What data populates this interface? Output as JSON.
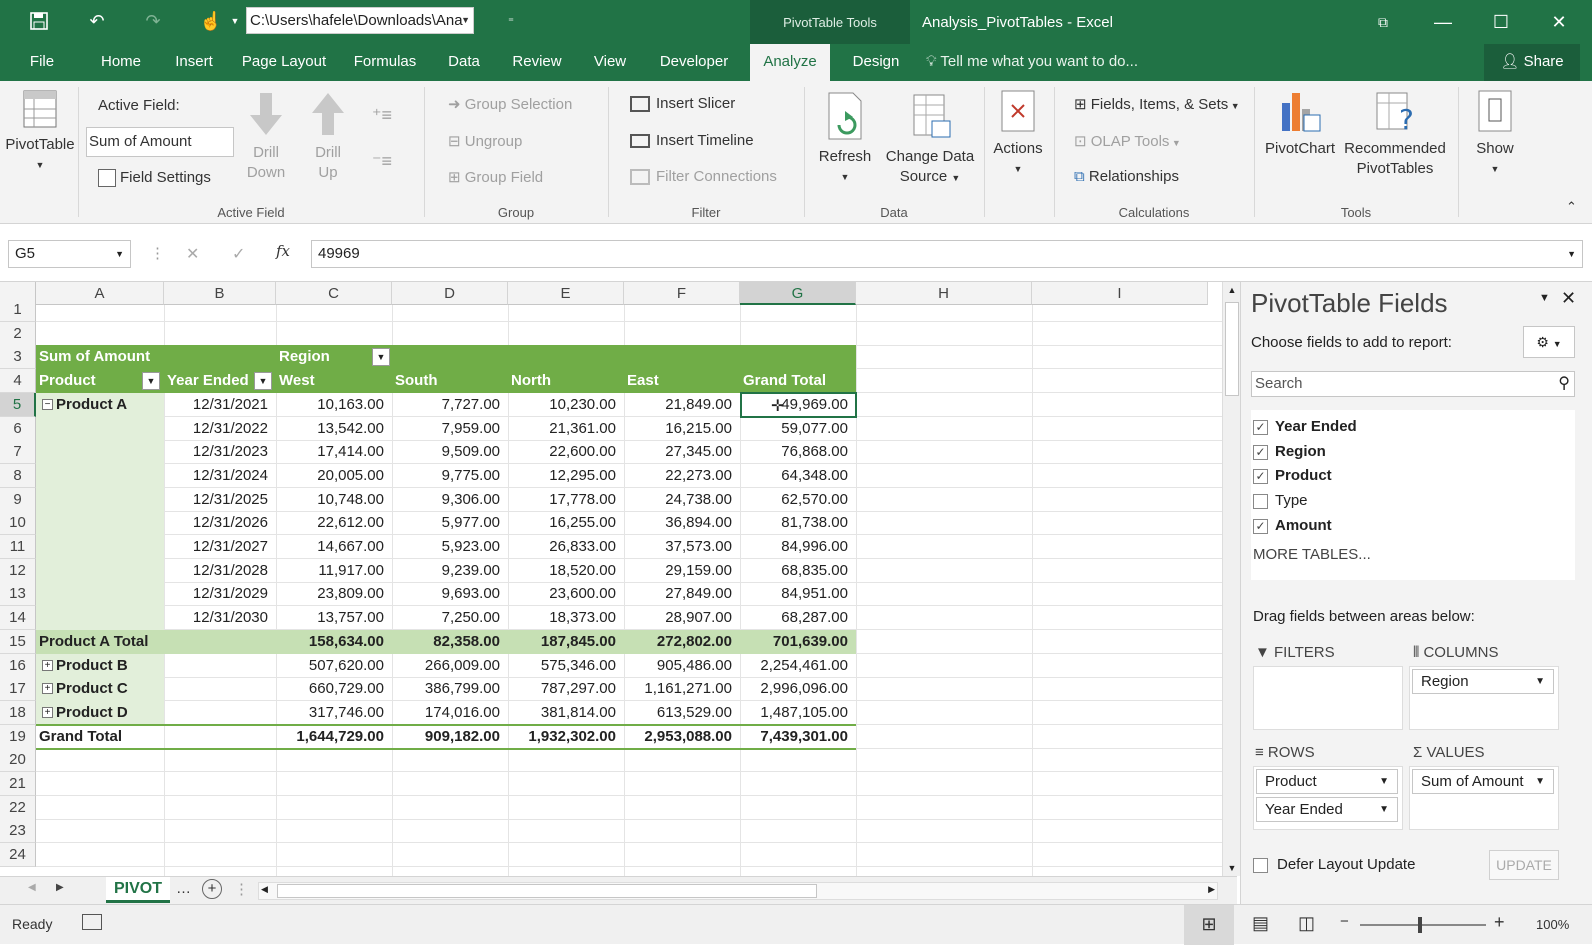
{
  "app": {
    "doc_title": "Analysis_PivotTables - Excel",
    "context_tab": "PivotTable Tools",
    "path": "C:\\Users\\hafele\\Downloads\\Ana"
  },
  "tabs": [
    "File",
    "Home",
    "Insert",
    "Page Layout",
    "Formulas",
    "Data",
    "Review",
    "View",
    "Developer",
    "Analyze",
    "Design"
  ],
  "active_tab": "Analyze",
  "tell_me": "Tell me what you want to do...",
  "share": "Share",
  "ribbon": {
    "pivottable": "PivotTable",
    "active_field_label": "Active Field:",
    "active_field_value": "Sum of Amount",
    "field_settings": "Field Settings",
    "drill_down": [
      "Drill",
      "Down"
    ],
    "drill_up": [
      "Drill",
      "Up"
    ],
    "group_active_field": "Active Field",
    "group_selection": "Group Selection",
    "ungroup": "Ungroup",
    "group_field": "Group Field",
    "group_group": "Group",
    "insert_slicer": "Insert Slicer",
    "insert_timeline": "Insert Timeline",
    "filter_connections": "Filter Connections",
    "group_filter": "Filter",
    "refresh": "Refresh",
    "change_source": [
      "Change Data",
      "Source"
    ],
    "group_data": "Data",
    "actions": "Actions",
    "fields_items_sets": "Fields, Items, & Sets",
    "olap_tools": "OLAP Tools",
    "relationships": "Relationships",
    "group_calculations": "Calculations",
    "pivotchart": "PivotChart",
    "recommended": [
      "Recommended",
      "PivotTables"
    ],
    "group_tools": "Tools",
    "show": "Show"
  },
  "formula_bar": {
    "name_box": "G5",
    "value": "49969"
  },
  "columns": [
    "A",
    "B",
    "C",
    "D",
    "E",
    "F",
    "G",
    "H",
    "I"
  ],
  "rows": [
    "1",
    "2",
    "3",
    "4",
    "5",
    "6",
    "7",
    "8",
    "9",
    "10",
    "11",
    "12",
    "13",
    "14",
    "15",
    "16",
    "17",
    "18",
    "19",
    "20",
    "21",
    "22",
    "23",
    "24"
  ],
  "pivot": {
    "values_label": "Sum of Amount",
    "columns_label": "Region",
    "row_label": "Product",
    "row2_label": "Year Ended",
    "regions": [
      "West",
      "South",
      "North",
      "East",
      "Grand Total"
    ],
    "product_a": "Product A",
    "detail": [
      [
        "12/31/2021",
        "10,163.00",
        "7,727.00",
        "10,230.00",
        "21,849.00",
        "49,969.00"
      ],
      [
        "12/31/2022",
        "13,542.00",
        "7,959.00",
        "21,361.00",
        "16,215.00",
        "59,077.00"
      ],
      [
        "12/31/2023",
        "17,414.00",
        "9,509.00",
        "22,600.00",
        "27,345.00",
        "76,868.00"
      ],
      [
        "12/31/2024",
        "20,005.00",
        "9,775.00",
        "12,295.00",
        "22,273.00",
        "64,348.00"
      ],
      [
        "12/31/2025",
        "10,748.00",
        "9,306.00",
        "17,778.00",
        "24,738.00",
        "62,570.00"
      ],
      [
        "12/31/2026",
        "22,612.00",
        "5,977.00",
        "16,255.00",
        "36,894.00",
        "81,738.00"
      ],
      [
        "12/31/2027",
        "14,667.00",
        "5,923.00",
        "26,833.00",
        "37,573.00",
        "84,996.00"
      ],
      [
        "12/31/2028",
        "11,917.00",
        "9,239.00",
        "18,520.00",
        "29,159.00",
        "68,835.00"
      ],
      [
        "12/31/2029",
        "23,809.00",
        "9,693.00",
        "23,600.00",
        "27,849.00",
        "84,951.00"
      ],
      [
        "12/31/2030",
        "13,757.00",
        "7,250.00",
        "18,373.00",
        "28,907.00",
        "68,287.00"
      ]
    ],
    "subtotal": [
      "Product A Total",
      "158,634.00",
      "82,358.00",
      "187,845.00",
      "272,802.00",
      "701,639.00"
    ],
    "collapsed": [
      [
        "Product B",
        "507,620.00",
        "266,009.00",
        "575,346.00",
        "905,486.00",
        "2,254,461.00"
      ],
      [
        "Product C",
        "660,729.00",
        "386,799.00",
        "787,297.00",
        "1,161,271.00",
        "2,996,096.00"
      ],
      [
        "Product D",
        "317,746.00",
        "174,016.00",
        "381,814.00",
        "613,529.00",
        "1,487,105.00"
      ]
    ],
    "grand": [
      "Grand Total",
      "1,644,729.00",
      "909,182.00",
      "1,932,302.00",
      "2,953,088.00",
      "7,439,301.00"
    ]
  },
  "sheet_tab": "PIVOT",
  "status": {
    "ready": "Ready",
    "zoom": "100%"
  },
  "panel": {
    "title": "PivotTable Fields",
    "choose": "Choose fields to add to report:",
    "search_placeholder": "Search",
    "fields": [
      {
        "name": "Year Ended",
        "checked": true
      },
      {
        "name": "Region",
        "checked": true
      },
      {
        "name": "Product",
        "checked": true
      },
      {
        "name": "Type",
        "checked": false
      },
      {
        "name": "Amount",
        "checked": true
      }
    ],
    "more_tables": "MORE TABLES...",
    "drag": "Drag fields between areas below:",
    "filters": "FILTERS",
    "columns": "COLUMNS",
    "rows": "ROWS",
    "values": "VALUES",
    "col_items": [
      "Region"
    ],
    "row_items": [
      "Product",
      "Year Ended"
    ],
    "val_items": [
      "Sum of Amount"
    ],
    "defer": "Defer Layout Update",
    "update": "UPDATE"
  },
  "colors": {
    "excel_green": "#217346",
    "pivot_header": "#70ad47",
    "pivot_band": "#e2efda",
    "subtotal": "#c6e0b4"
  }
}
